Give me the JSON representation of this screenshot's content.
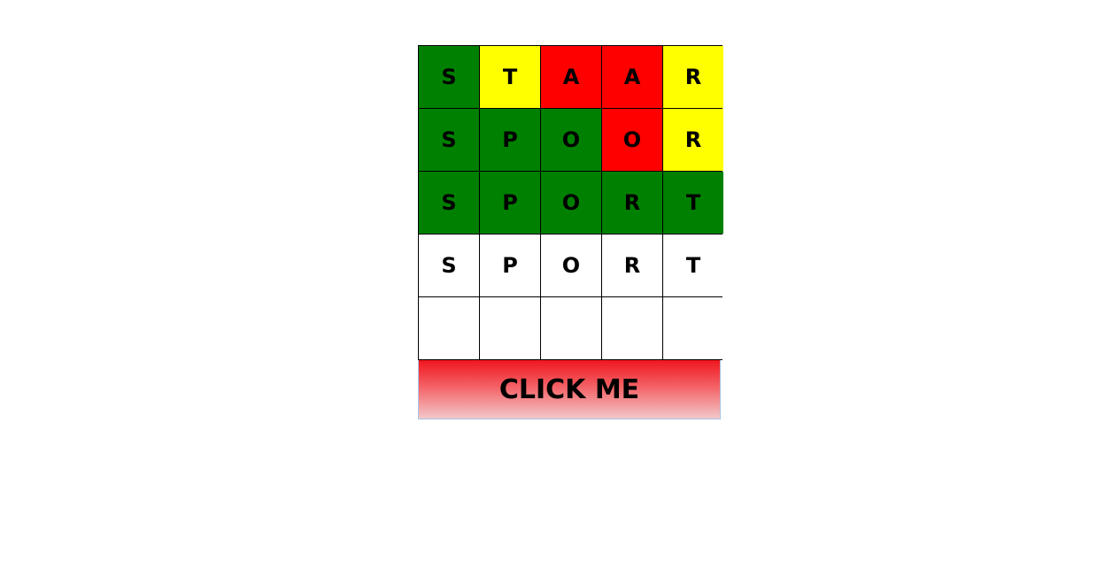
{
  "colors": {
    "green": "#008000",
    "yellow": "#ffff00",
    "red": "#ff0000",
    "empty": "#ffffff"
  },
  "board": {
    "rows": [
      [
        {
          "letter": "S",
          "status": "green"
        },
        {
          "letter": "T",
          "status": "yellow"
        },
        {
          "letter": "A",
          "status": "red"
        },
        {
          "letter": "A",
          "status": "red"
        },
        {
          "letter": "R",
          "status": "yellow"
        }
      ],
      [
        {
          "letter": "S",
          "status": "green"
        },
        {
          "letter": "P",
          "status": "green"
        },
        {
          "letter": "O",
          "status": "green"
        },
        {
          "letter": "O",
          "status": "red"
        },
        {
          "letter": "R",
          "status": "yellow"
        }
      ],
      [
        {
          "letter": "S",
          "status": "green"
        },
        {
          "letter": "P",
          "status": "green"
        },
        {
          "letter": "O",
          "status": "green"
        },
        {
          "letter": "R",
          "status": "green"
        },
        {
          "letter": "T",
          "status": "green"
        }
      ],
      [
        {
          "letter": "S",
          "status": "empty"
        },
        {
          "letter": "P",
          "status": "empty"
        },
        {
          "letter": "O",
          "status": "empty"
        },
        {
          "letter": "R",
          "status": "empty"
        },
        {
          "letter": "T",
          "status": "empty"
        }
      ],
      [
        {
          "letter": "",
          "status": "empty"
        },
        {
          "letter": "",
          "status": "empty"
        },
        {
          "letter": "",
          "status": "empty"
        },
        {
          "letter": "",
          "status": "empty"
        },
        {
          "letter": "",
          "status": "empty"
        }
      ]
    ]
  },
  "button": {
    "label": "CLICK ME"
  }
}
